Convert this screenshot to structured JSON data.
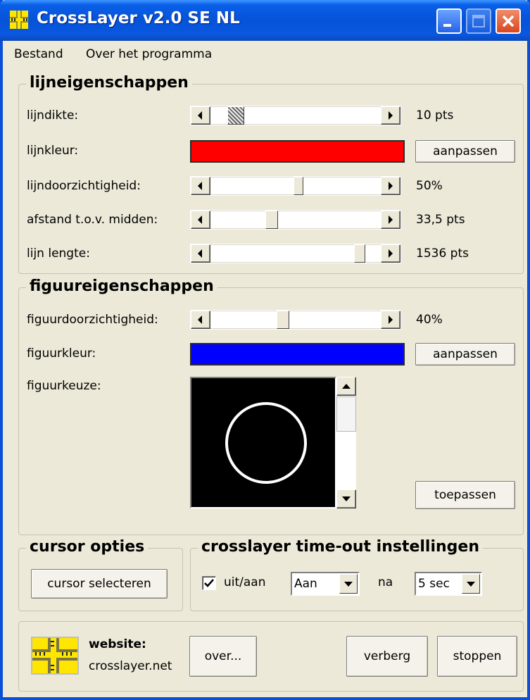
{
  "window": {
    "title": "CrossLayer v2.0 SE NL"
  },
  "menu": [
    "Bestand",
    "Over het programma"
  ],
  "line_props": {
    "title": "lijneigenschappen",
    "rows": [
      {
        "label": "lijndikte:",
        "value": "10 pts"
      },
      {
        "label": "lijnkleur:",
        "color": "#ff0000",
        "button": "aanpassen"
      },
      {
        "label": "lijndoorzichtigheid:",
        "value": "50%"
      },
      {
        "label": "afstand t.o.v. midden:",
        "value": "33,5 pts"
      },
      {
        "label": "lijn lengte:",
        "value": "1536 pts"
      }
    ]
  },
  "shape_props": {
    "title": "figuureigenschappen",
    "transparency_label": "figuurdoorzichtigheid:",
    "transparency_value": "40%",
    "color_label": "figuurkleur:",
    "color": "#0000ff",
    "color_button": "aanpassen",
    "choice_label": "figuurkeuze:",
    "apply_button": "toepassen"
  },
  "cursor": {
    "title": "cursor opties",
    "button": "cursor selecteren"
  },
  "timeout": {
    "title": "crosslayer time-out instellingen",
    "checkbox_label": "uit/aan",
    "checked": true,
    "mode": "Aan",
    "after_label": "na",
    "delay": "5 sec"
  },
  "footer": {
    "website_label": "website:",
    "website": "crosslayer.net",
    "about_button": "over...",
    "hide_button": "verberg",
    "stop_button": "stoppen"
  },
  "colors": {
    "titlebar": "#0553d8",
    "window_bg": "#ece9d8",
    "accent_yellow": "#ffe600"
  }
}
